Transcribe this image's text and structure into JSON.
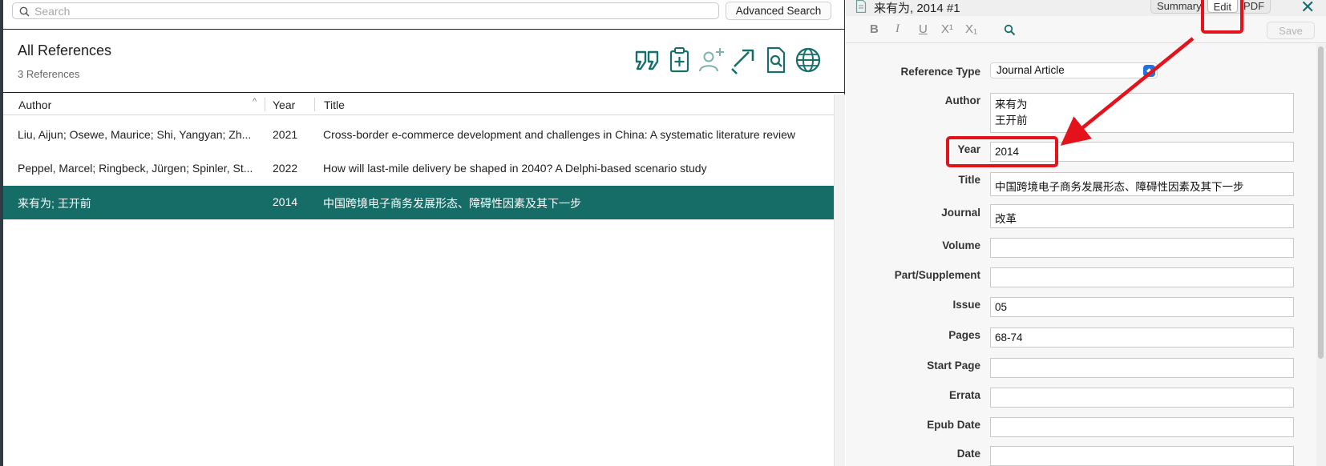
{
  "search": {
    "placeholder": "Search",
    "advanced_label": "Advanced Search"
  },
  "library": {
    "group_title": "All References",
    "count_text": "3 References"
  },
  "toolbar_icons": [
    "insert-citation-icon",
    "copy-formatted-icon",
    "share-user-icon",
    "export-arrow-icon",
    "find-fulltext-icon",
    "online-search-globe-icon"
  ],
  "table": {
    "columns": [
      "Author",
      "Year",
      "Title"
    ],
    "sort_indicator": "^",
    "rows": [
      {
        "author": "Liu, Aijun; Osewe, Maurice; Shi, Yangyan; Zh...",
        "year": "2021",
        "title": "Cross-border e-commerce development and challenges in China: A systematic literature review",
        "selected": false
      },
      {
        "author": "Peppel, Marcel; Ringbeck, Jürgen; Spinler, St...",
        "year": "2022",
        "title": "How will last-mile delivery be shaped in 2040? A Delphi-based scenario study",
        "selected": false
      },
      {
        "author": "来有为; 王开前",
        "year": "2014",
        "title": "中国跨境电子商务发展形态、障碍性因素及其下一步",
        "selected": true
      }
    ]
  },
  "reference": {
    "header_label": "来有为, 2014 #1",
    "tabs": [
      "Summary",
      "Edit",
      "PDF"
    ],
    "active_tab": "Edit",
    "close_glyph": "✕",
    "format_buttons": [
      "B",
      "I",
      "U",
      "X¹",
      "X₁"
    ],
    "save_label": "Save",
    "type_label": "Reference Type",
    "type_value": "Journal Article",
    "fields": [
      {
        "label": "Author",
        "value": "来有为\n王开前"
      },
      {
        "label": "Year",
        "value": "2014"
      },
      {
        "label": "Title",
        "value": "中国跨境电子商务发展形态、障碍性因素及其下一步"
      },
      {
        "label": "Journal",
        "value": "改革"
      },
      {
        "label": "Volume",
        "value": ""
      },
      {
        "label": "Part/Supplement",
        "value": ""
      },
      {
        "label": "Issue",
        "value": "05"
      },
      {
        "label": "Pages",
        "value": "68-74"
      },
      {
        "label": "Start Page",
        "value": ""
      },
      {
        "label": "Errata",
        "value": ""
      },
      {
        "label": "Epub Date",
        "value": ""
      },
      {
        "label": "Date",
        "value": ""
      }
    ]
  },
  "annotation_color": "#e3121b",
  "accent_color": "#166d68"
}
